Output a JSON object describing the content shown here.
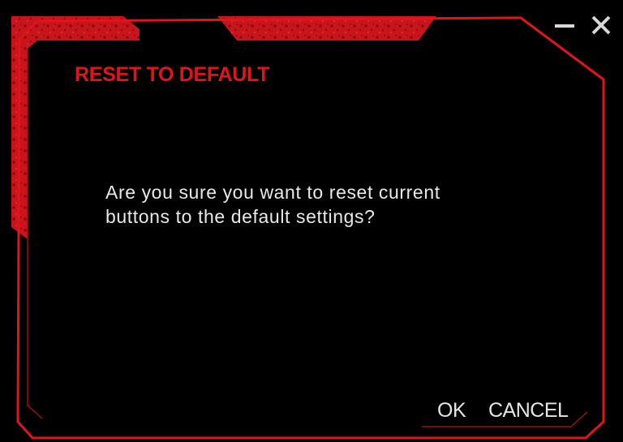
{
  "dialog": {
    "title": "RESET TO DEFAULT",
    "message_line1": "Are you sure you want to reset current",
    "message_line2": "buttons to the default settings?"
  },
  "window_controls": {
    "minimize_icon": "minimize-icon",
    "close_icon": "close-icon"
  },
  "buttons": {
    "ok_label": "OK",
    "cancel_label": "CANCEL"
  },
  "colors": {
    "background": "#000000",
    "accent_red": "#e0141c",
    "text": "#e8e8e8"
  }
}
